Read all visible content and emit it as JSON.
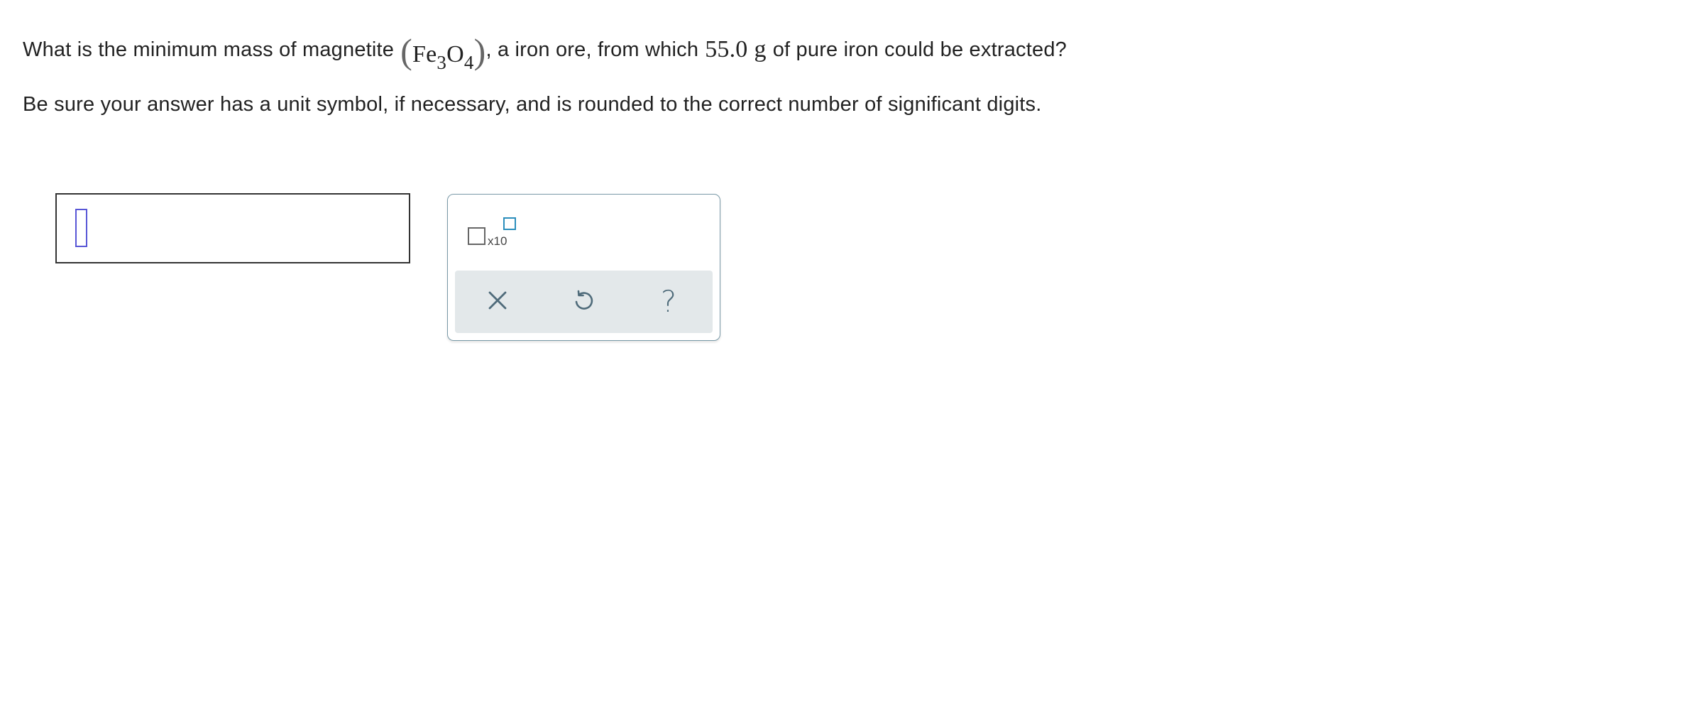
{
  "question": {
    "text_before": "What is the minimum mass of magnetite",
    "formula": {
      "open_paren": "(",
      "element1": "Fe",
      "sub1": "3",
      "element2": "O",
      "sub2": "4",
      "close_paren": ")"
    },
    "text_middle": ", a iron ore, from which",
    "mass_value": "55.0",
    "mass_unit": "g",
    "text_after": "of pure iron could be extracted?"
  },
  "instruction": "Be sure your answer has a unit symbol, if necessary, and is rounded to the correct number of significant digits.",
  "answer_input": {
    "value": ""
  },
  "palette": {
    "scientific_notation_label": "x10",
    "buttons": [
      {
        "name": "clear",
        "icon": "close-icon"
      },
      {
        "name": "undo",
        "icon": "undo-icon"
      },
      {
        "name": "help",
        "icon": "help-icon",
        "glyph": "?"
      }
    ]
  },
  "colors": {
    "text": "#222222",
    "cursor": "#5856d6",
    "accent": "#2b8ebc",
    "toolbar_bg": "#e3e8ea",
    "icon": "#4f6b7a"
  }
}
